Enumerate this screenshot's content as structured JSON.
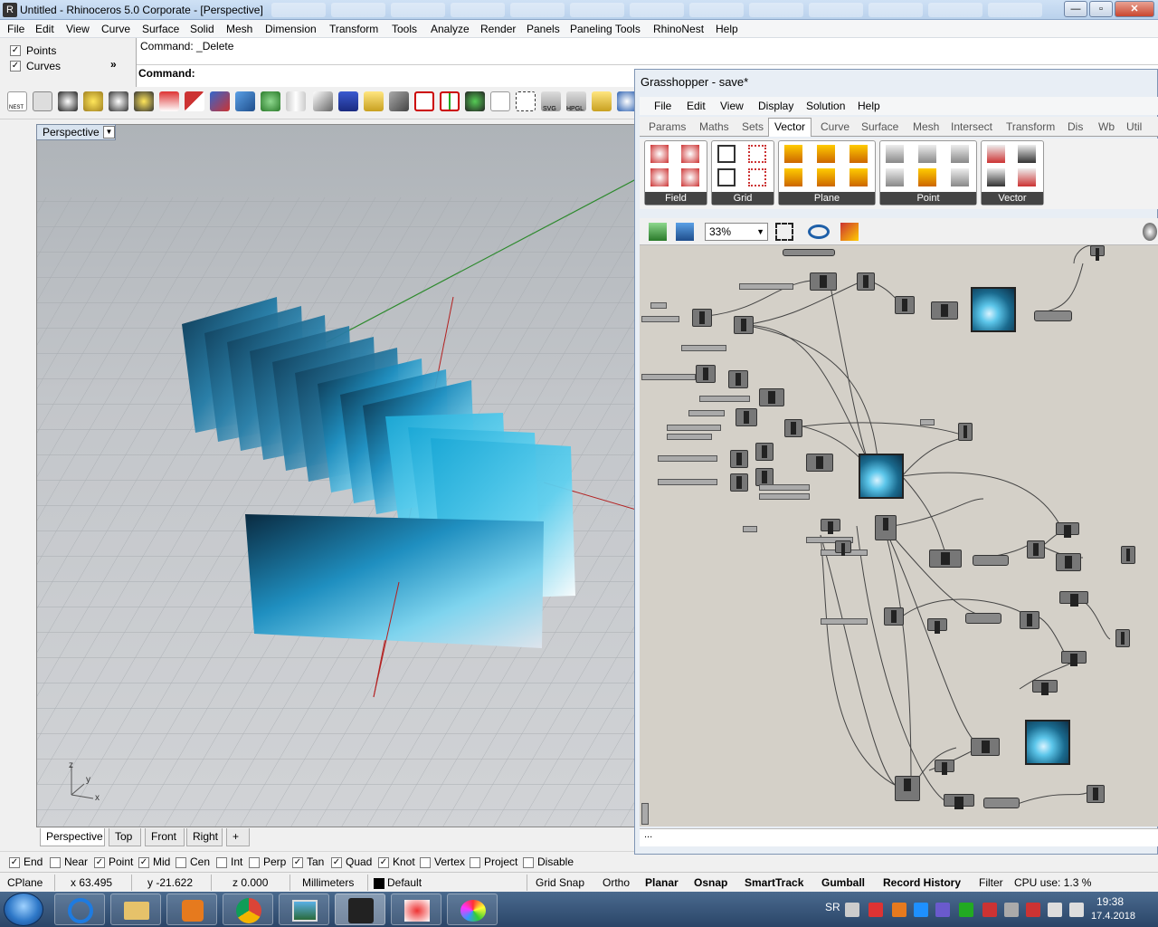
{
  "window": {
    "title": "Untitled - Rhinoceros  5.0 Corporate - [Perspective]",
    "minimize": "—",
    "maximize": "▫",
    "close": "✕"
  },
  "menu": [
    "File",
    "Edit",
    "View",
    "Curve",
    "Surface",
    "Solid",
    "Mesh",
    "Dimension",
    "Transform",
    "Tools",
    "Analyze",
    "Render",
    "Panels",
    "Paneling Tools",
    "RhinoNest",
    "Help"
  ],
  "filters": {
    "points_label": "Points",
    "curves_label": "Curves",
    "expand": "»"
  },
  "command": {
    "history": "Command: _Delete",
    "prompt": "Command:"
  },
  "toolbar": {
    "nest_label": "NEST",
    "svg_label": "SVG",
    "hpgl_label": "HPGL"
  },
  "viewport": {
    "name": "Perspective",
    "axis_x": "x",
    "axis_y": "y",
    "axis_z": "z",
    "tabs": [
      "Perspective",
      "Top",
      "Front",
      "Right"
    ],
    "add_tab": "+"
  },
  "osnap": [
    {
      "label": "End",
      "checked": true
    },
    {
      "label": "Near",
      "checked": false
    },
    {
      "label": "Point",
      "checked": true
    },
    {
      "label": "Mid",
      "checked": true
    },
    {
      "label": "Cen",
      "checked": false
    },
    {
      "label": "Int",
      "checked": false
    },
    {
      "label": "Perp",
      "checked": false
    },
    {
      "label": "Tan",
      "checked": true
    },
    {
      "label": "Quad",
      "checked": true
    },
    {
      "label": "Knot",
      "checked": true
    },
    {
      "label": "Vertex",
      "checked": false
    },
    {
      "label": "Project",
      "checked": false
    },
    {
      "label": "Disable",
      "checked": false
    }
  ],
  "status": {
    "cplane": "CPlane",
    "x": "x 63.495",
    "y": "y -21.622",
    "z": "z 0.000",
    "units": "Millimeters",
    "layer": "Default",
    "grid_snap": "Grid Snap",
    "ortho": "Ortho",
    "planar": "Planar",
    "osnap": "Osnap",
    "smarttrack": "SmartTrack",
    "gumball": "Gumball",
    "record_history": "Record History",
    "filter": "Filter",
    "cpu": "CPU use: 1.3 %"
  },
  "taskbar": {
    "language": "SR",
    "time": "19:38",
    "date": "17.4.2018"
  },
  "grasshopper": {
    "title": "Grasshopper - save*",
    "menu": [
      "File",
      "Edit",
      "View",
      "Display",
      "Solution",
      "Help"
    ],
    "tabs": [
      "Params",
      "Maths",
      "Sets",
      "Vector",
      "Curve",
      "Surface",
      "Mesh",
      "Intersect",
      "Transform",
      "Dis",
      "Wb",
      "Util"
    ],
    "active_tab": "Vector",
    "groups": [
      "Field",
      "Grid",
      "Plane",
      "Point",
      "Vector"
    ],
    "zoom": "33%",
    "footer": "..."
  },
  "colors": {
    "accent": "#3399ff",
    "viewport_bg": "#c3c6ca",
    "gh_canvas": "#d4d0c8"
  }
}
